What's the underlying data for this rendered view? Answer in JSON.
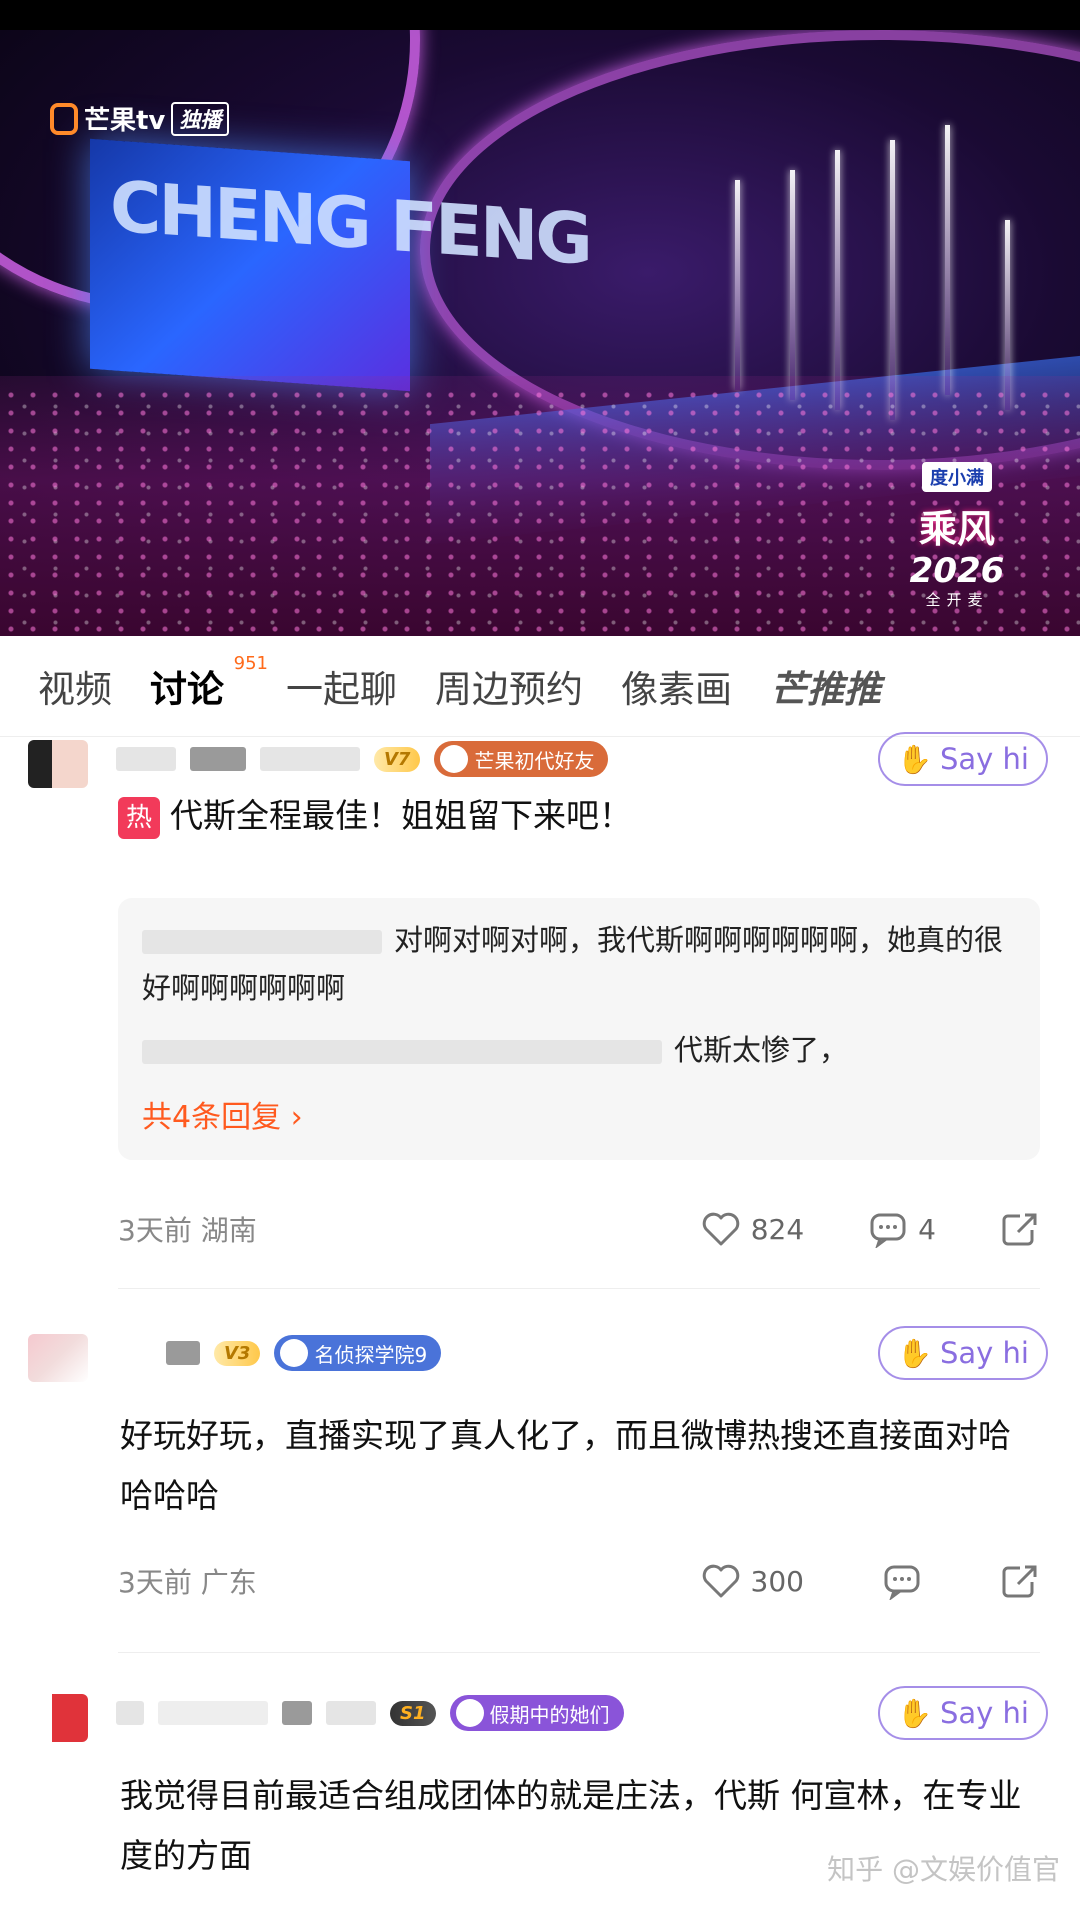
{
  "video": {
    "platform_logo": "芒果tv",
    "platform_tag": "独播",
    "show_brand": "乘风",
    "show_year": "2026",
    "show_sub": "全开麦",
    "sponsor": "度小满",
    "screen_text": "CHENG FENG"
  },
  "tabs": [
    {
      "label": "视频",
      "active": false
    },
    {
      "label": "讨论",
      "active": true,
      "count": "951"
    },
    {
      "label": "一起聊",
      "active": false
    },
    {
      "label": "周边预约",
      "active": false
    },
    {
      "label": "像素画",
      "active": false
    },
    {
      "label": "芒推推",
      "active": false
    }
  ],
  "comments": [
    {
      "level": "V7",
      "badge": "芒果初代好友",
      "badge_color": "#d96b3a",
      "sayhi": "Say hi",
      "hot_tag": "热",
      "text": "代斯全程最佳！姐姐留下来吧！",
      "replies": [
        "对啊对啊对啊，我代斯啊啊啊啊啊啊，她真的很好啊啊啊啊啊啊",
        "代斯太惨了，"
      ],
      "more_replies": "共4条回复",
      "time_location": "3天前 湖南",
      "likes": "824",
      "comment_count": "4"
    },
    {
      "level": "V3",
      "badge": "名侦探学院9",
      "badge_color": "#4a73d9",
      "sayhi": "Say hi",
      "text": "好玩好玩，直播实现了真人化了，而且微博热搜还直接面对哈哈哈哈",
      "time_location": "3天前 广东",
      "likes": "300"
    },
    {
      "level": "S1",
      "badge": "假期中的她们",
      "badge_color": "#8a54d9",
      "sayhi": "Say hi",
      "text": "我觉得目前最适合组成团体的就是庄法，代斯 何宣林，在专业度的方面"
    }
  ],
  "watermark": "知乎 @文娱价值官",
  "colors": {
    "accent_orange": "#ff5a1f",
    "sayhi_purple": "#8a6ee0",
    "hot_red": "#f23a5a"
  }
}
